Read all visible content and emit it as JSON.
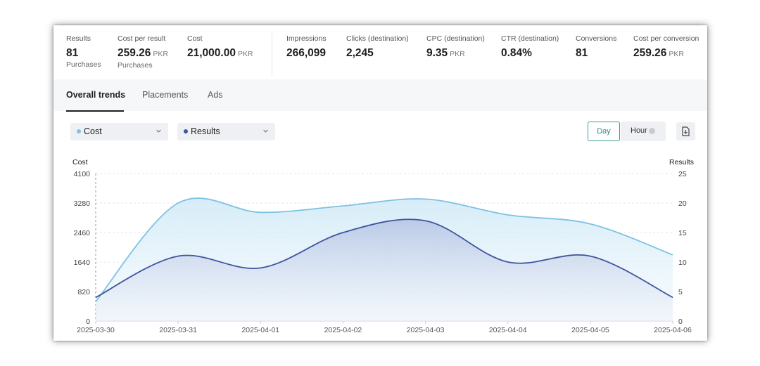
{
  "metrics": [
    {
      "label": "Results",
      "value": "81",
      "unit": "",
      "sub": "Purchases"
    },
    {
      "label": "Cost per result",
      "value": "259.26",
      "unit": "PKR",
      "sub": "Purchases"
    },
    {
      "label": "Cost",
      "value": "21,000.00",
      "unit": "PKR",
      "sub": ""
    },
    {
      "label": "Impressions",
      "value": "266,099",
      "unit": "",
      "sub": ""
    },
    {
      "label": "Clicks (destination)",
      "value": "2,245",
      "unit": "",
      "sub": ""
    },
    {
      "label": "CPC (destination)",
      "value": "9.35",
      "unit": "PKR",
      "sub": ""
    },
    {
      "label": "CTR (destination)",
      "value": "0.84%",
      "unit": "",
      "sub": ""
    },
    {
      "label": "Conversions",
      "value": "81",
      "unit": "",
      "sub": ""
    },
    {
      "label": "Cost per conversion",
      "value": "259.26",
      "unit": "PKR",
      "sub": ""
    }
  ],
  "tabs": [
    "Overall trends",
    "Placements",
    "Ads"
  ],
  "controls": {
    "series1": "Cost",
    "series2": "Results",
    "day": "Day",
    "hour": "Hour"
  },
  "colors": {
    "cost": "#7cc2e3",
    "results": "#3e55a0",
    "active_border": "#3d9a96"
  },
  "chart_data": {
    "type": "area",
    "left_axis_label": "Cost",
    "right_axis_label": "Results",
    "x": [
      "2025-03-30",
      "2025-03-31",
      "2025-04-01",
      "2025-04-02",
      "2025-04-03",
      "2025-04-04",
      "2025-04-05",
      "2025-04-06"
    ],
    "y_left_ticks": [
      0,
      820,
      1640,
      2460,
      3280,
      4100
    ],
    "y_right_ticks": [
      0,
      5,
      10,
      15,
      20,
      25
    ],
    "ylim_left": [
      0,
      4100
    ],
    "ylim_right": [
      0,
      25
    ],
    "series": [
      {
        "name": "Cost",
        "axis": "left",
        "values": [
          540,
          3280,
          3020,
          3200,
          3390,
          2950,
          2700,
          1840
        ]
      },
      {
        "name": "Results",
        "axis": "right",
        "values": [
          4,
          11,
          9,
          15,
          17,
          10,
          11,
          4
        ]
      }
    ]
  }
}
